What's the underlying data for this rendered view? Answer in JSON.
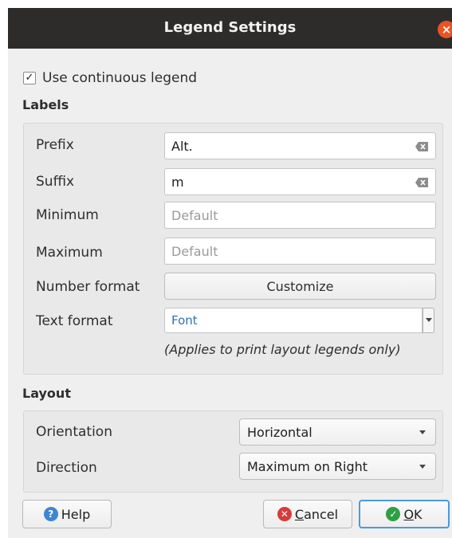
{
  "dialog": {
    "title": "Legend Settings",
    "close_glyph": "×"
  },
  "continuous": {
    "checked": true,
    "check_glyph": "✓",
    "label": "Use continuous legend"
  },
  "labels": {
    "group_title": "Labels",
    "prefix": {
      "label": "Prefix",
      "value": "Alt."
    },
    "suffix": {
      "label": "Suffix",
      "value": "m"
    },
    "minimum": {
      "label": "Minimum",
      "placeholder": "Default"
    },
    "maximum": {
      "label": "Maximum",
      "placeholder": "Default"
    },
    "number_format": {
      "label": "Number format",
      "button": "Customize"
    },
    "text_format": {
      "label": "Text format",
      "value": "Font"
    },
    "note": "(Applies to print layout legends only)"
  },
  "layout": {
    "group_title": "Layout",
    "orientation": {
      "label": "Orientation",
      "value": "Horizontal"
    },
    "direction": {
      "label": "Direction",
      "value": "Maximum on Right"
    }
  },
  "footer": {
    "help": {
      "glyph": "?",
      "label": "Help"
    },
    "cancel": {
      "glyph": "✕",
      "mnemonic": "C",
      "rest": "ancel"
    },
    "ok": {
      "glyph": "✓",
      "mnemonic": "O",
      "rest": "K"
    }
  },
  "colors": {
    "titlebar": "#2d2c2b",
    "close": "#e95420",
    "help_icon": "#3d85d6",
    "cancel_icon": "#d83b3b",
    "ok_icon": "#2ea043",
    "ok_focus": "#4a9adb",
    "font_text": "#2f6fb8"
  }
}
